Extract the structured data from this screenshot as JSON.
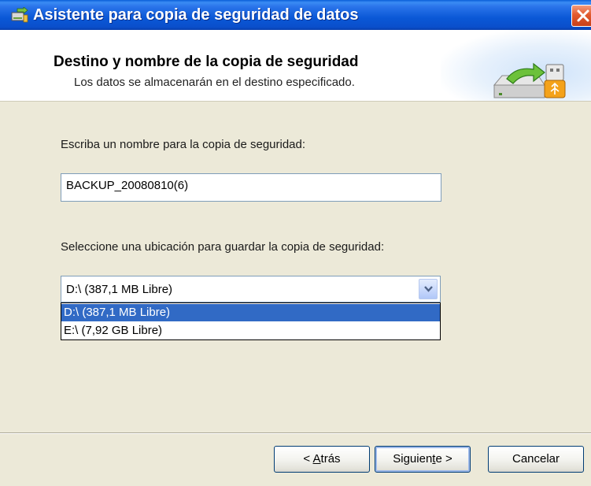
{
  "window": {
    "title": "Asistente para copia de seguridad de datos"
  },
  "header": {
    "title": "Destino y nombre de la copia de seguridad",
    "subtitle": "Los datos se almacenarán en el destino especificado."
  },
  "form": {
    "name_label": "Escriba un nombre para la copia de seguridad:",
    "name_value": "BACKUP_20080810(6)",
    "location_label": "Seleccione una ubicación para guardar la copia de seguridad:",
    "location_selected": "D:\\ (387,1 MB Libre)",
    "location_options": [
      "D:\\ (387,1 MB Libre)",
      "E:\\ (7,92 GB Libre)"
    ]
  },
  "buttons": {
    "back_prefix": "< ",
    "back_mnemonic": "A",
    "back_rest": "trás",
    "next_prefix": "Siguien",
    "next_mnemonic": "t",
    "next_rest": "e >",
    "cancel": "Cancelar"
  },
  "colors": {
    "titlebar": "#0a58d6",
    "selection": "#316ac5",
    "dialog_bg": "#ece9d8"
  },
  "icons": {
    "title": "backup-wizard-icon",
    "close": "close-icon",
    "header": "drive-to-usb-icon",
    "combo": "chevron-down-icon"
  }
}
